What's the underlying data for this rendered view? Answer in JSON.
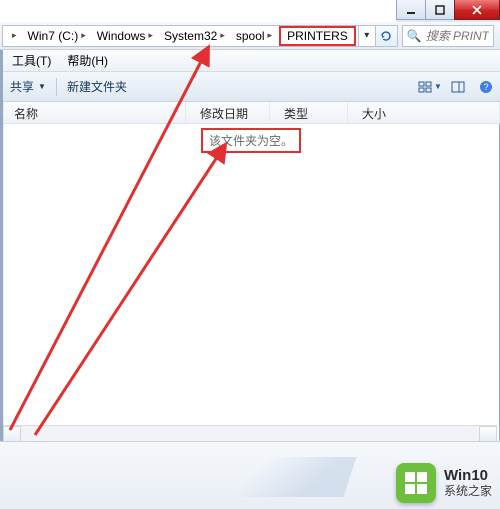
{
  "titlebar": {
    "minimize_tip": "最小化",
    "maximize_tip": "最大化",
    "close_tip": "关闭"
  },
  "breadcrumb": {
    "items": [
      {
        "label": "Win7 (C:)"
      },
      {
        "label": "Windows"
      },
      {
        "label": "System32"
      },
      {
        "label": "spool"
      },
      {
        "label": "PRINTERS",
        "current": true
      }
    ]
  },
  "search": {
    "placeholder": "搜索 PRINTERS"
  },
  "menu": {
    "tools": "工具(T)",
    "help": "帮助(H)"
  },
  "cmdbar": {
    "share": "共享",
    "new_folder": "新建文件夹"
  },
  "columns": {
    "name": "名称",
    "date": "修改日期",
    "type": "类型",
    "size": "大小"
  },
  "content": {
    "empty_msg": "该文件夹为空。"
  },
  "watermark": {
    "line1": "Win10",
    "line2": "系统之家"
  }
}
